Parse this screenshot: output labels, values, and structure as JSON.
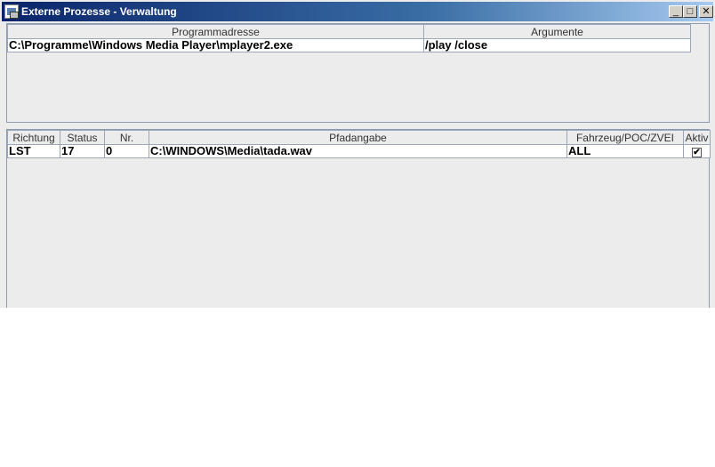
{
  "window": {
    "title": "Externe Prozesse - Verwaltung",
    "buttons": {
      "minimize": "_",
      "maximize": "□",
      "close": "✕"
    }
  },
  "programs": {
    "columns": [
      "Programmadresse",
      "Argumente"
    ],
    "rows": [
      [
        "C:\\Programme\\Windows Media Player\\mplayer2.exe",
        "/play /close"
      ]
    ]
  },
  "processes": {
    "columns": [
      "Richtung",
      "Status",
      "Nr.",
      "Pfadangabe",
      "Fahrzeug/POC/ZVEI",
      "Aktiv"
    ],
    "rows": [
      {
        "richtung": "LST",
        "status": "17",
        "nr": "0",
        "pfad": "C:\\WINDOWS\\Media\\tada.wav",
        "fahrzeug": "ALL",
        "aktiv": true
      }
    ]
  },
  "icons": {
    "app": "app-window-icon",
    "checkbox": "checkbox-checked-icon"
  }
}
